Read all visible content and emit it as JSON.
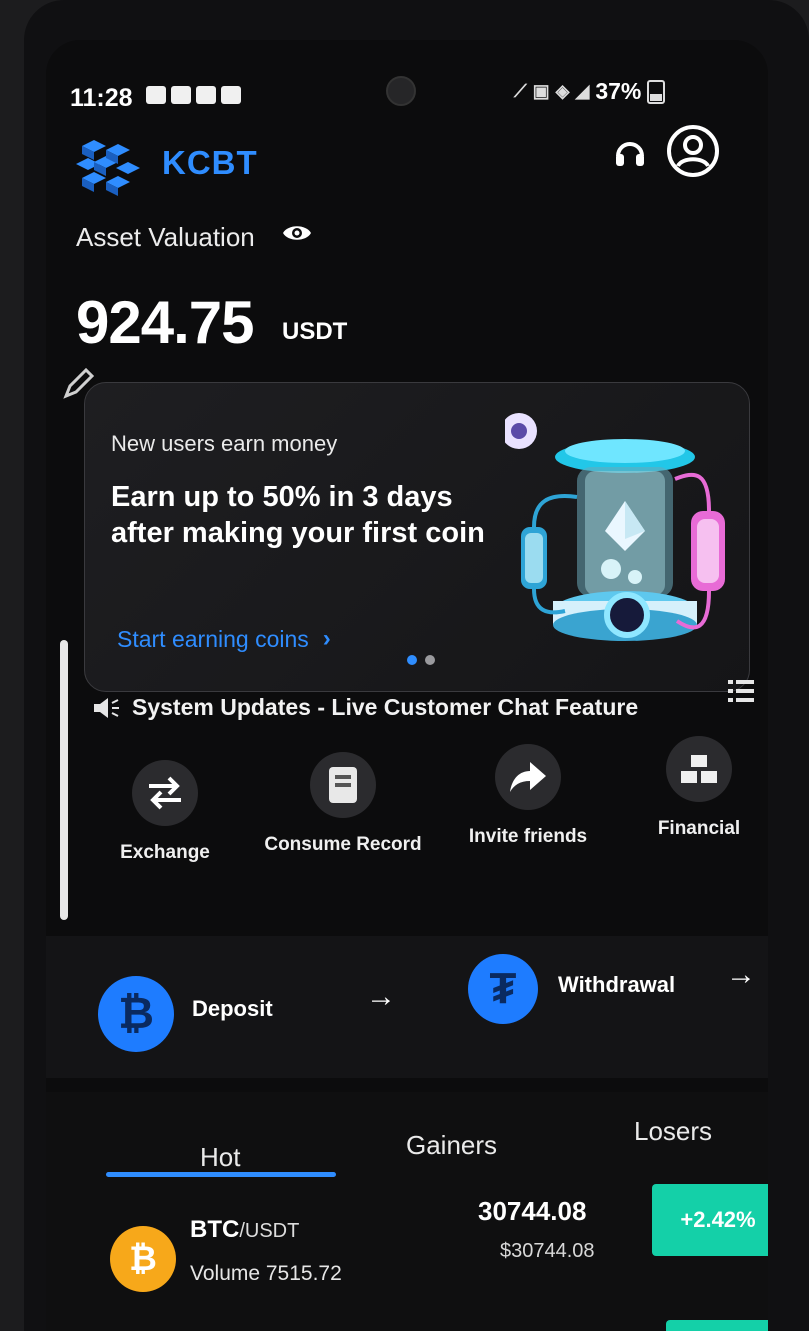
{
  "status_bar": {
    "time": "11:28",
    "battery": "37%"
  },
  "header": {
    "brand": "KCBT"
  },
  "asset": {
    "label": "Asset Valuation",
    "value": "924.75",
    "unit": "USDT"
  },
  "promo": {
    "kicker": "New users earn money",
    "headline": "Earn up to 50% in 3 days after making your first coin",
    "link": "Start earning coins",
    "slides_total": 2,
    "slide_active": 1
  },
  "announcement": {
    "text": "System Updates - Live Customer Chat Feature"
  },
  "quick_actions": [
    {
      "label": "Exchange",
      "icon": "exchange-arrows-icon"
    },
    {
      "label": "Consume Record",
      "icon": "record-book-icon"
    },
    {
      "label": "Invite friends",
      "icon": "share-arrow-icon"
    },
    {
      "label": "Financial",
      "icon": "gold-bars-icon"
    }
  ],
  "transfer": {
    "deposit_label": "Deposit",
    "withdraw_label": "Withdrawal"
  },
  "market": {
    "tabs": [
      "Hot",
      "Gainers",
      "Losers"
    ],
    "active_tab": "Hot",
    "rows": [
      {
        "base": "BTC",
        "quote": "/USDT",
        "volume": "Volume 7515.72",
        "price": "30744.08",
        "price_fiat": "$30744.08",
        "change": "+2.42%"
      }
    ]
  },
  "colors": {
    "accent": "#2f8dff",
    "positive": "#14d0a8",
    "btc": "#f7a81a"
  }
}
